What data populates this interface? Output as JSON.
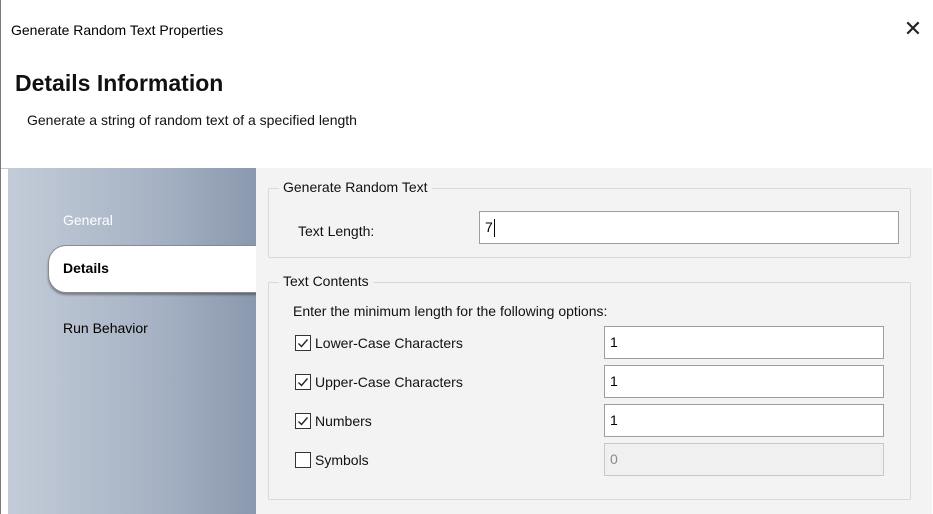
{
  "window": {
    "title": "Generate Random Text Properties",
    "close_glyph": "✕"
  },
  "header": {
    "title": "Details Information",
    "subtitle": "Generate a string of random text of a specified length"
  },
  "sidebar": {
    "items": [
      {
        "label": "General",
        "state": "inactive"
      },
      {
        "label": "Details",
        "state": "selected"
      },
      {
        "label": "Run Behavior",
        "state": "inactive"
      }
    ]
  },
  "generate_group": {
    "legend": "Generate Random Text",
    "text_length_label": "Text Length:",
    "text_length_value": "7"
  },
  "contents_group": {
    "legend": "Text Contents",
    "instruction": "Enter the minimum length for the following options:",
    "options": [
      {
        "label": "Lower-Case Characters",
        "checked": true,
        "value": "1",
        "enabled": true
      },
      {
        "label": "Upper-Case Characters",
        "checked": true,
        "value": "1",
        "enabled": true
      },
      {
        "label": "Numbers",
        "checked": true,
        "value": "1",
        "enabled": true
      },
      {
        "label": "Symbols",
        "checked": false,
        "value": "0",
        "enabled": false
      }
    ]
  },
  "icons": {
    "close": "close-icon",
    "check": "checkmark-icon"
  }
}
